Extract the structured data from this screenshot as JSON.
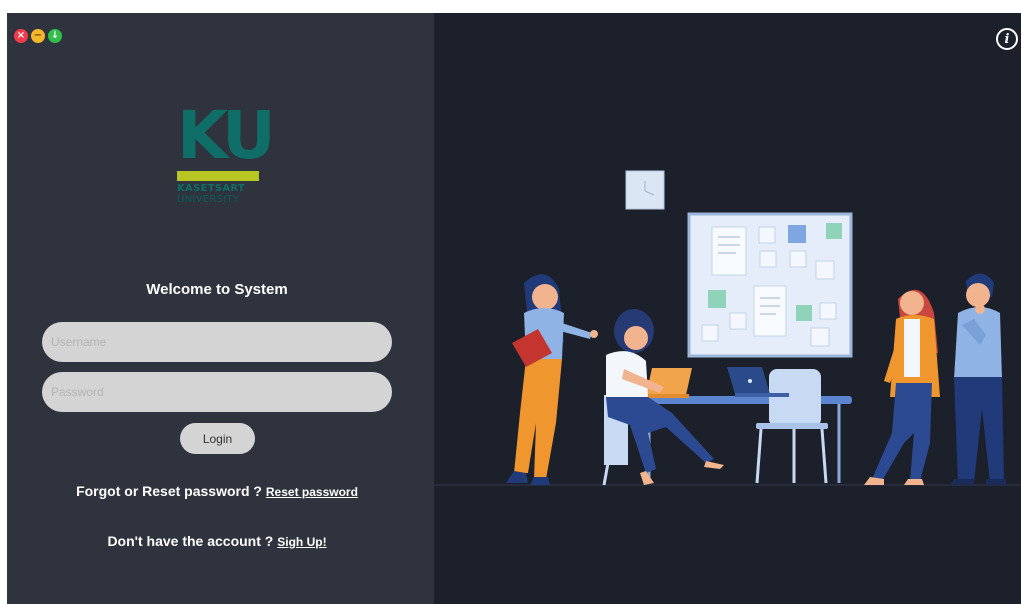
{
  "window": {
    "controls": {
      "close_glyph": "×",
      "minimize_glyph": "−",
      "maximize_glyph": "↓"
    },
    "info_glyph": "i"
  },
  "logo": {
    "mark": "KU",
    "line1": "KASETSART",
    "line2": "UNIVERSITY",
    "colors": {
      "teal": "#0f6e67",
      "lime": "#b7c623"
    }
  },
  "login": {
    "welcome": "Welcome to System",
    "username_placeholder": "Username",
    "password_placeholder": "Password",
    "login_label": "Login",
    "forgot_text": "Forgot or Reset password ?",
    "reset_link": "Reset password",
    "signup_text": "Don't have the account ?",
    "signup_link": "Sigh Up!"
  },
  "theme": {
    "left_bg": "#2f333d",
    "right_bg": "#1c202b",
    "field_bg": "#d4d4d4"
  }
}
